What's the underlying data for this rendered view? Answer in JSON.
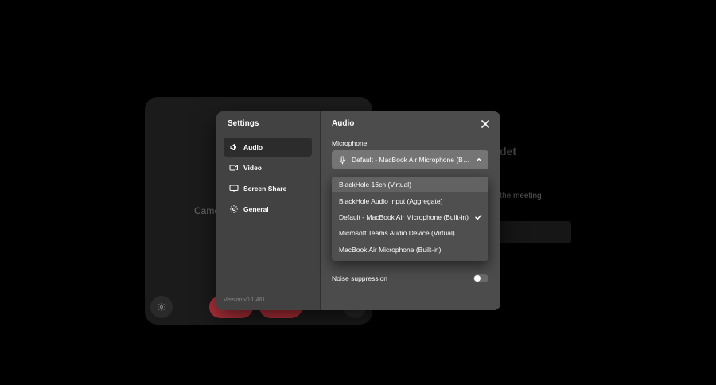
{
  "background": {
    "camera_text": "Came",
    "join_heading": "det",
    "join_sub": "n the meeting"
  },
  "settings": {
    "title": "Settings",
    "version": "Version v0.1.481",
    "sidebar": {
      "items": [
        {
          "label": "Audio",
          "icon": "speaker-icon",
          "active": true
        },
        {
          "label": "Video",
          "icon": "video-camera-icon",
          "active": false
        },
        {
          "label": "Screen Share",
          "icon": "monitor-icon",
          "active": false
        },
        {
          "label": "General",
          "icon": "gear-icon",
          "active": false
        }
      ]
    },
    "content": {
      "title": "Audio",
      "microphone_label": "Microphone",
      "microphone_selected": "Default - MacBook Air Microphone (Built-in)",
      "noise_suppression_label": "Noise suppression",
      "noise_suppression_enabled": false
    },
    "dropdown": {
      "options": [
        {
          "label": "BlackHole 16ch (Virtual)",
          "hovered": true,
          "selected": false
        },
        {
          "label": "BlackHole Audio Input (Aggregate)",
          "hovered": false,
          "selected": false
        },
        {
          "label": "Default - MacBook Air Microphone (Built-in)",
          "hovered": false,
          "selected": true
        },
        {
          "label": "Microsoft Teams Audio Device (Virtual)",
          "hovered": false,
          "selected": false
        },
        {
          "label": "MacBook Air Microphone (Built-in)",
          "hovered": false,
          "selected": false
        }
      ]
    }
  },
  "colors": {
    "background": "#000000",
    "sidebar": "#424242",
    "content": "#4c4c4c",
    "select": "#757575",
    "danger": "#b3313a"
  }
}
